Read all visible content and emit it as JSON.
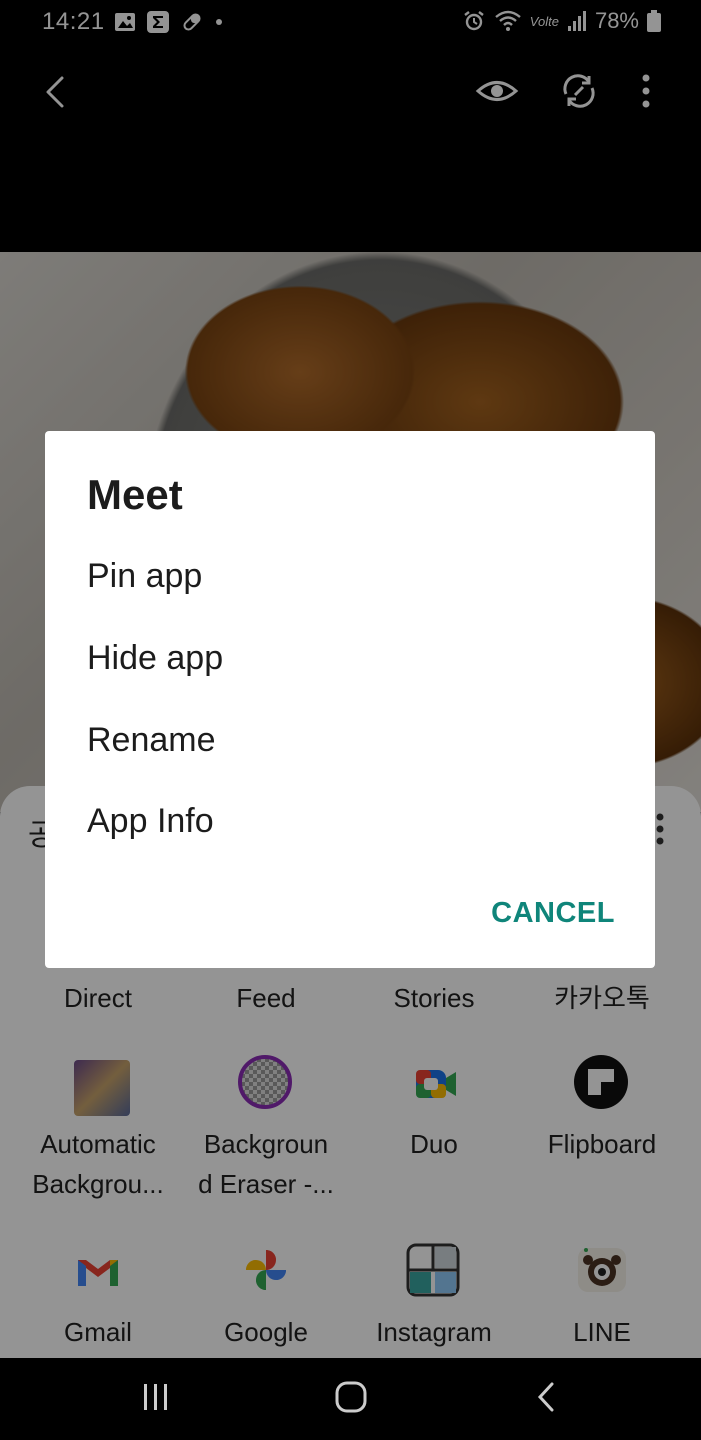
{
  "status_bar": {
    "time": "14:21",
    "battery": "78%",
    "network": "Volte"
  },
  "toolbar": {
    "back_icon": "chevron-left-icon",
    "view_icon": "eye-icon",
    "rotate_icon": "rotate-icon",
    "more_icon": "more-vertical-icon"
  },
  "share_sheet": {
    "title_partial": "공",
    "rows": [
      [
        "Direct",
        "Feed",
        "Stories",
        "카카오톡"
      ],
      [
        "Automatic\nBackgrou...",
        "Backgroun\nd Eraser -...",
        "Duo",
        "Flipboard"
      ],
      [
        "Gmail",
        "Google",
        "Instagram",
        "LINE"
      ]
    ]
  },
  "dialog": {
    "title": "Meet",
    "items": [
      "Pin app",
      "Hide app",
      "Rename",
      "App Info"
    ],
    "cancel": "CANCEL"
  },
  "colors": {
    "accent": "#0f857a",
    "scrim": "rgba(0,0,0,0.42)"
  }
}
